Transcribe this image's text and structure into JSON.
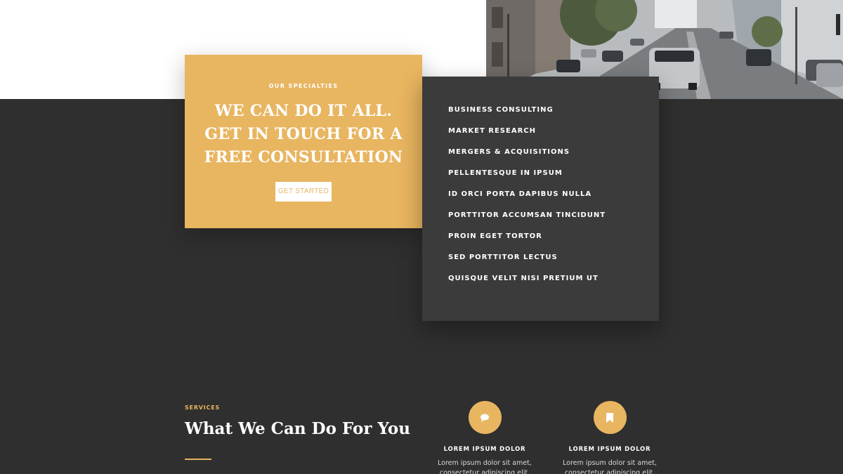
{
  "specialties": {
    "eyebrow": "OUR SPECIALTIES",
    "headline": "WE CAN DO IT ALL. GET IN TOUCH FOR A FREE CONSULTATION",
    "cta_label": "GET STARTED"
  },
  "services_list": [
    "BUSINESS CONSULTING",
    "MARKET RESEARCH",
    "MERGERS & ACQUISITIONS",
    "PELLENTESQUE IN IPSUM",
    "ID ORCI PORTA DAPIBUS NULLA",
    "PORTTITOR ACCUMSAN TINCIDUNT",
    "PROIN EGET TORTOR",
    "SED PORTTITOR LECTUS",
    "QUISQUE VELIT NISI PRETIUM UT"
  ],
  "services": {
    "label": "SERVICES",
    "title": "What We Can Do For You",
    "features": [
      {
        "icon": "chat-bubble-icon",
        "title": "LOREM IPSUM DOLOR",
        "body": "Lorem ipsum dolor sit amet, consectetur adipiscing elit."
      },
      {
        "icon": "bookmark-icon",
        "title": "LOREM IPSUM DOLOR",
        "body": "Lorem ipsum dolor sit amet, consectetur adipiscing elit."
      }
    ]
  },
  "colors": {
    "accent": "#e8b560",
    "dark_background": "#2f2f2f",
    "list_card": "#3b3b3b"
  }
}
